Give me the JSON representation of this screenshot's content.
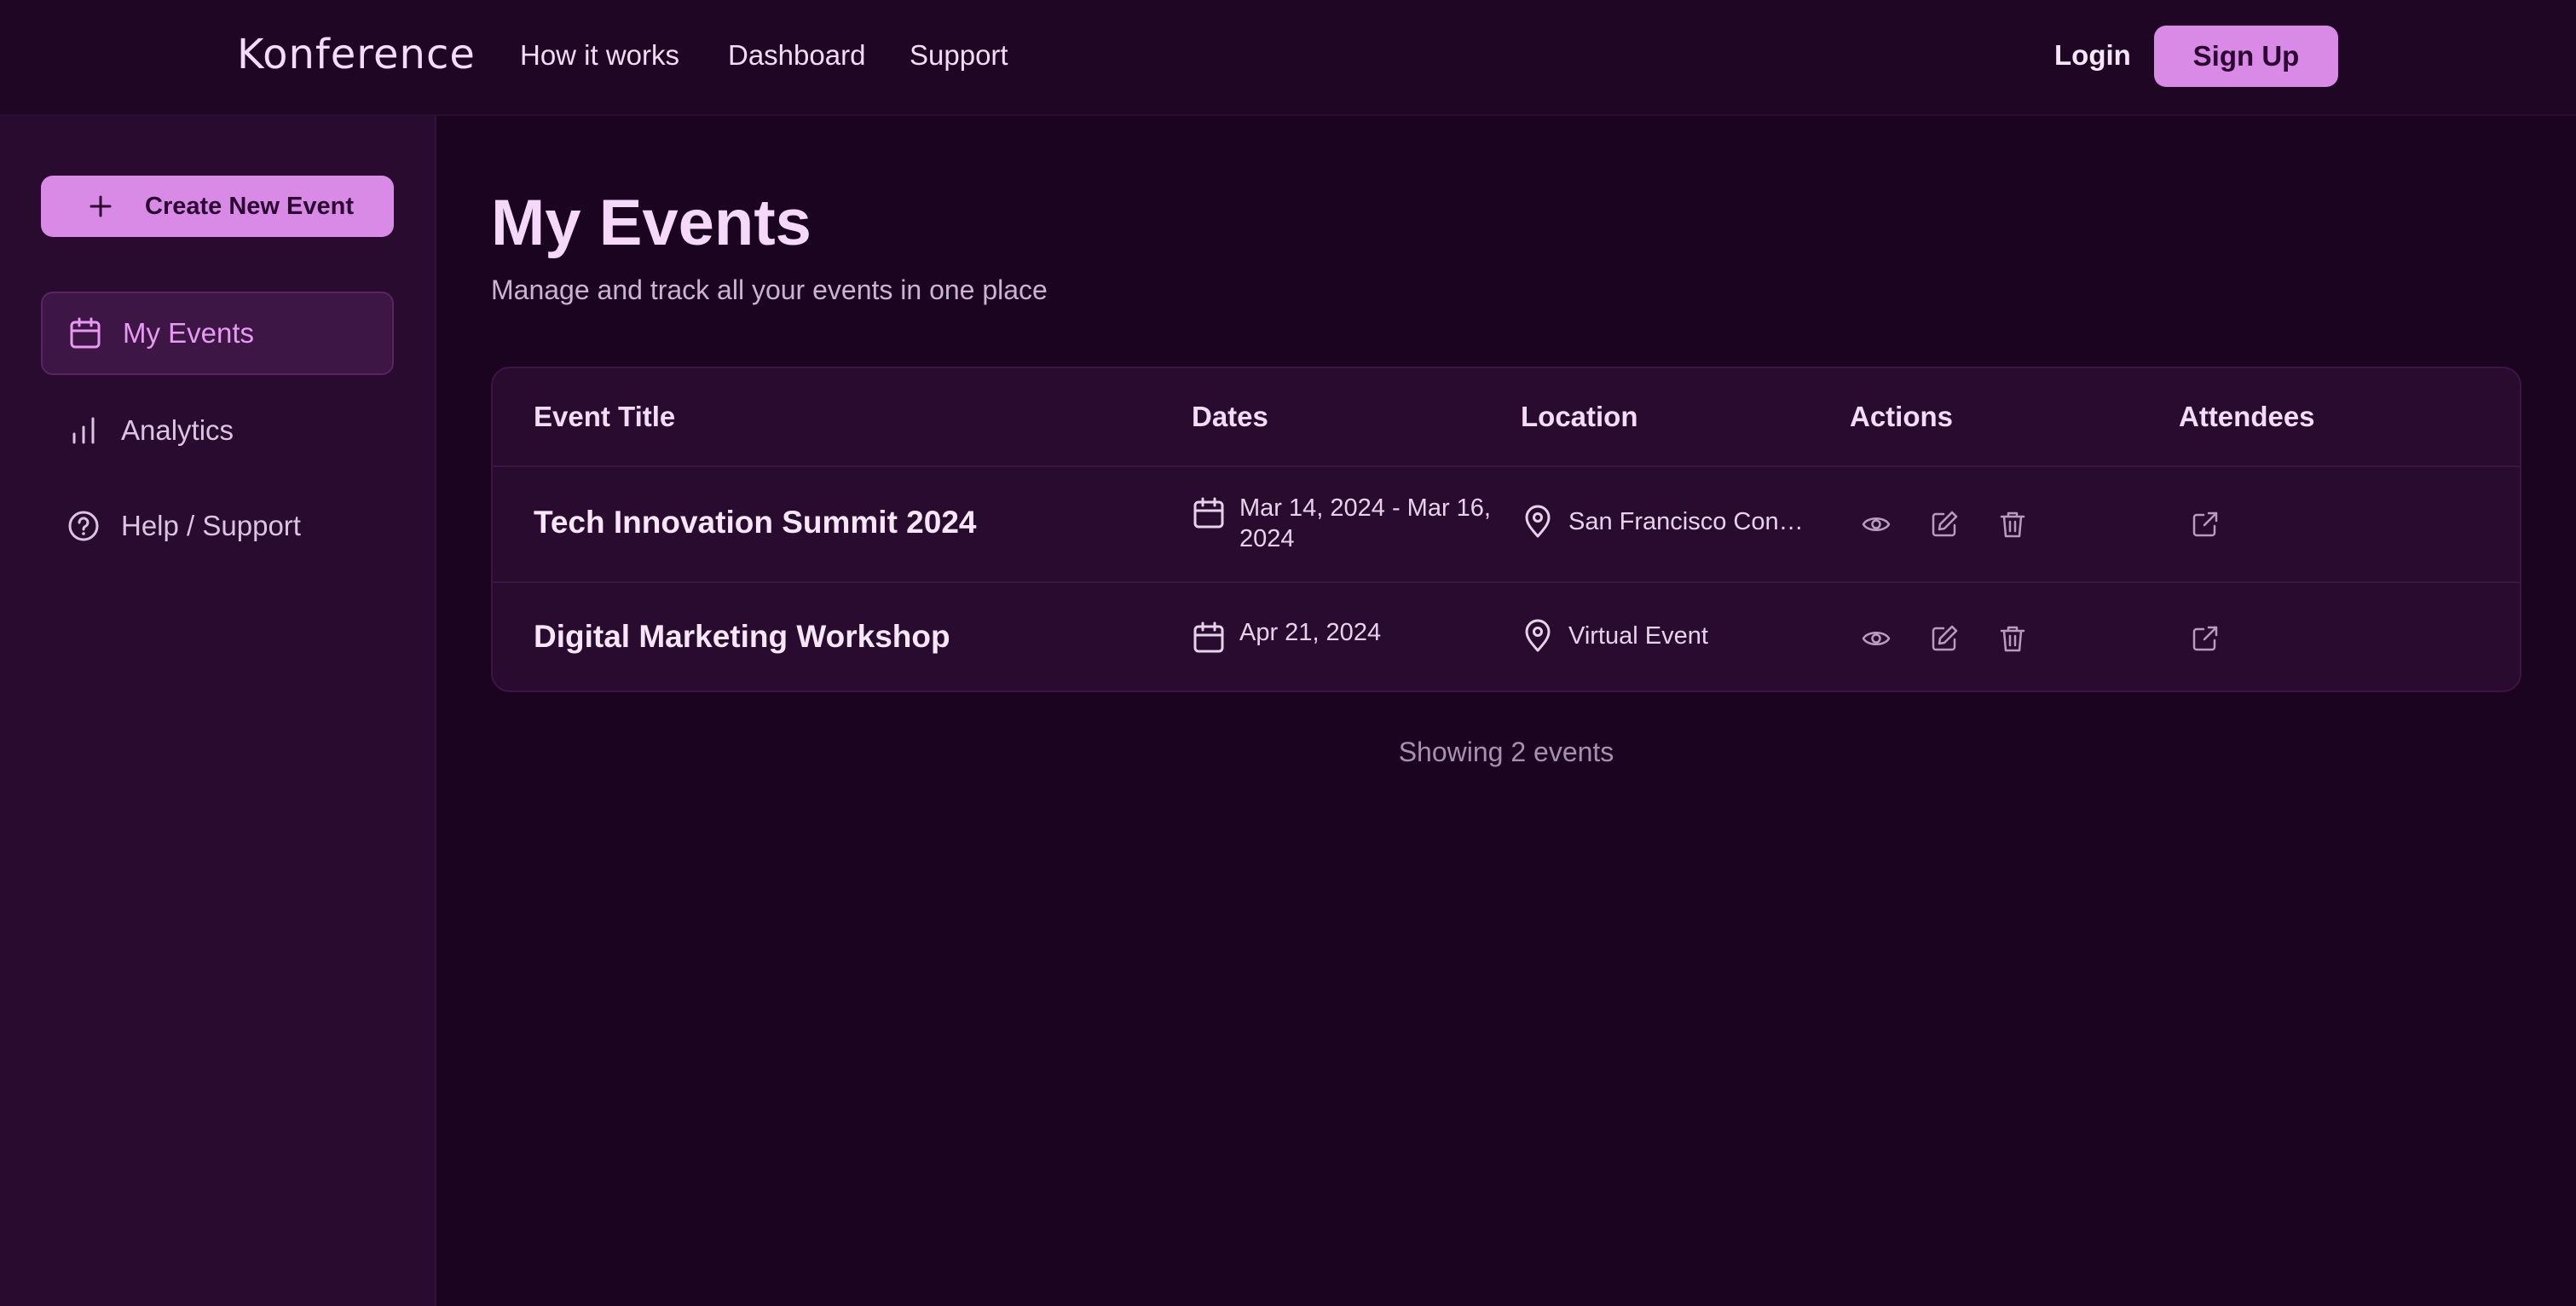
{
  "header": {
    "logo": "Konference",
    "nav": {
      "how_it_works": "How it works",
      "dashboard": "Dashboard",
      "support": "Support"
    },
    "login_label": "Login",
    "signup_label": "Sign Up"
  },
  "sidebar": {
    "create_label": "Create New Event",
    "items": [
      {
        "label": "My Events",
        "icon": "calendar-icon",
        "active": true
      },
      {
        "label": "Analytics",
        "icon": "bar-chart-icon",
        "active": false
      },
      {
        "label": "Help / Support",
        "icon": "help-circle-icon",
        "active": false
      }
    ]
  },
  "main": {
    "title": "My Events",
    "subtitle": "Manage and track all your events in one place",
    "table": {
      "columns": [
        "Event Title",
        "Dates",
        "Location",
        "Actions",
        "Attendees"
      ],
      "rows": [
        {
          "title": "Tech Innovation Summit 2024",
          "dates": "Mar 14, 2024 - Mar 16, 2024",
          "location": "San Francisco Convention Center",
          "actions": [
            "eye-icon",
            "edit-icon",
            "trash-icon"
          ],
          "attendees_icon": "external-link-icon"
        },
        {
          "title": "Digital Marketing Workshop",
          "dates": "Apr 21, 2024",
          "location": "Virtual Event",
          "actions": [
            "eye-icon",
            "edit-icon",
            "trash-icon"
          ],
          "attendees_icon": "external-link-icon"
        }
      ]
    },
    "showing_text": "Showing 2 events"
  },
  "colors": {
    "background": "#1b0420",
    "sidebar": "#2a0b30",
    "accent": "#d98ae6",
    "active_text": "#e79af1"
  }
}
